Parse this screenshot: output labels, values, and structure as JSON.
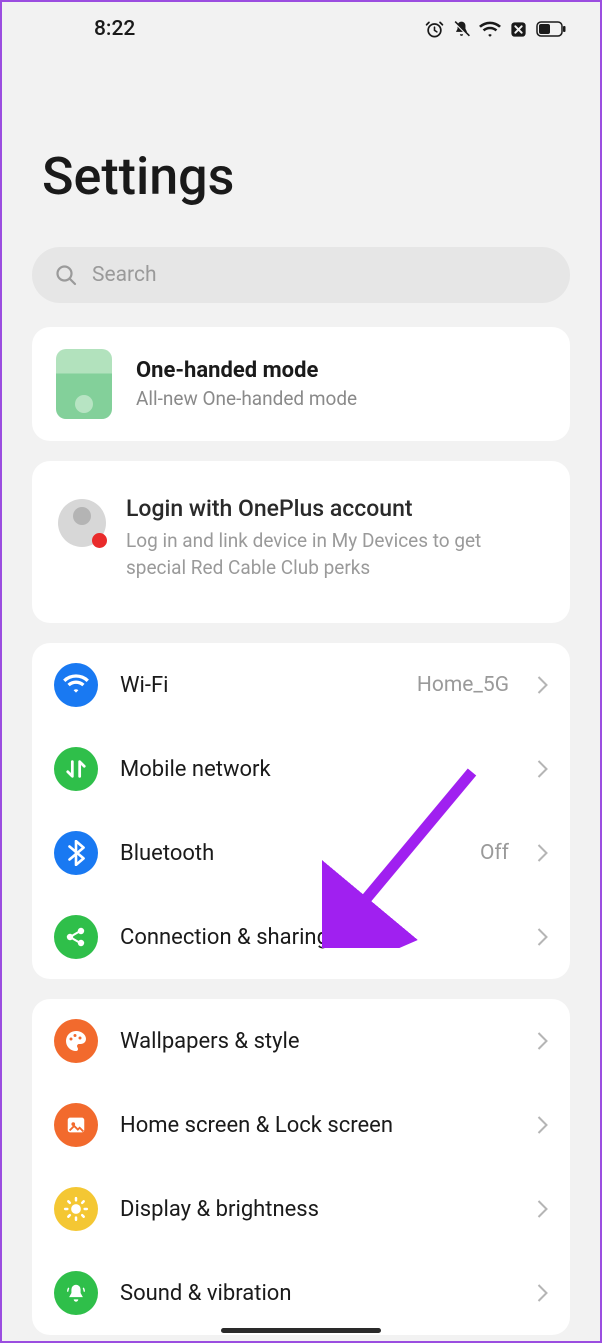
{
  "status": {
    "time": "8:22"
  },
  "title": "Settings",
  "search": {
    "placeholder": "Search"
  },
  "onehand": {
    "title": "One-handed mode",
    "subtitle": "All-new One-handed mode"
  },
  "account": {
    "title": "Login with OnePlus account",
    "subtitle": "Log in and link device in My Devices to get special Red Cable Club perks"
  },
  "net": {
    "wifi": {
      "label": "Wi-Fi",
      "value": "Home_5G"
    },
    "mobile": {
      "label": "Mobile network"
    },
    "bluetooth": {
      "label": "Bluetooth",
      "value": "Off"
    },
    "connection": {
      "label": "Connection & sharing"
    }
  },
  "display": {
    "wallpapers": {
      "label": "Wallpapers & style"
    },
    "home": {
      "label": "Home screen & Lock screen"
    },
    "brightness": {
      "label": "Display & brightness"
    },
    "sound": {
      "label": "Sound & vibration"
    }
  },
  "colors": {
    "wifi": "#1979f2",
    "mobile": "#2fbf4a",
    "bluetooth": "#1979f2",
    "connection": "#2fbf4a",
    "wallpapers": "#f26a2d",
    "home": "#f26a2d",
    "brightness": "#f4c733",
    "sound": "#2fbf4a"
  }
}
